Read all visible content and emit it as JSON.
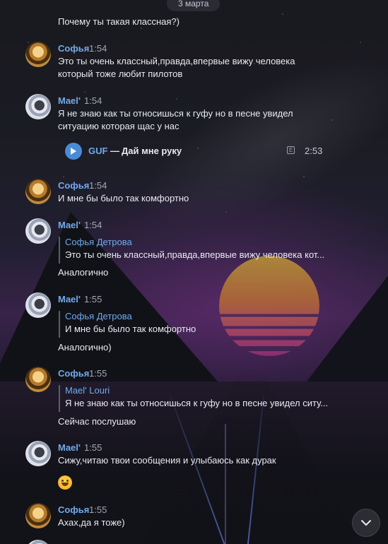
{
  "date_separator": "3 марта",
  "messages": [
    {
      "text": "Почему ты такая классная?)"
    },
    {
      "author": "Софья",
      "time": "1:54",
      "lines": [
        "Это ты очень классный,правда,впервые вижу человека",
        "который тоже любит пилотов"
      ]
    },
    {
      "author": "Mael'",
      "time": "1:54",
      "lines": [
        "Я не знаю как ты относишься к гуфу но в песне увидел",
        "ситуацию которая щас у нас"
      ],
      "audio": {
        "artist": "GUF",
        "separator": "—",
        "title": "Дай мне руку",
        "explicit": "E",
        "duration": "2:53"
      }
    },
    {
      "author": "Софья",
      "time": "1:54",
      "lines": [
        "И мне бы было так комфортно"
      ]
    },
    {
      "author": "Mael'",
      "time": "1:54",
      "reply": {
        "author": "Софья Детрова",
        "text": "Это ты очень классный,правда,впервые вижу человека кот..."
      },
      "lines": [
        "Аналогично"
      ]
    },
    {
      "author": "Mael'",
      "time": "1:55",
      "reply": {
        "author": "Софья Детрова",
        "text": "И мне бы было так комфортно"
      },
      "lines": [
        "Аналогично)"
      ]
    },
    {
      "author": "Софья",
      "time": "1:55",
      "reply": {
        "author": "Mael' Louri",
        "text": "Я не знаю как ты относишься к гуфу но в песне увидел ситу..."
      },
      "lines": [
        "Сейчас послушаю"
      ]
    },
    {
      "author": "Mael'",
      "time": "1:55",
      "lines": [
        "Сижу,читаю твои сообщения и улыбаюсь как дурак"
      ],
      "emoji": "grinning-face"
    },
    {
      "author": "Софья",
      "time": "1:55",
      "lines": [
        "Ахах,да я тоже)"
      ]
    }
  ],
  "icons": {
    "play": "play-icon",
    "scroll_down": "chevron-down-icon",
    "explicit": "explicit-badge-icon"
  },
  "colors": {
    "name": "#71aaeb",
    "text": "#e8eaef",
    "time": "#a3a7b0",
    "play_button": "#4a8bd6",
    "date_pill": "#2d2e36"
  }
}
